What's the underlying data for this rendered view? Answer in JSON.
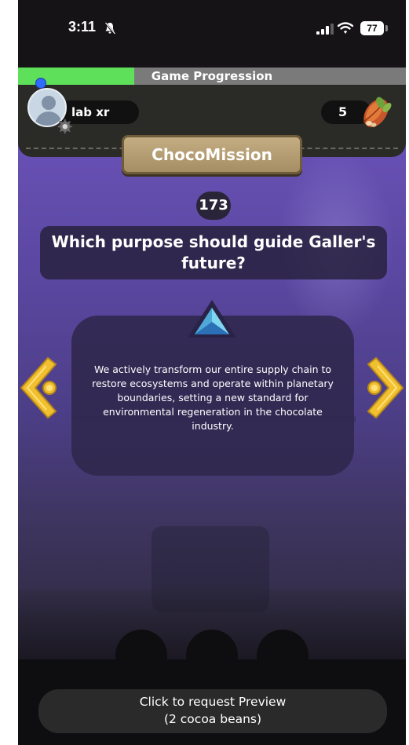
{
  "status_bar": {
    "time": "3:11",
    "battery": "77"
  },
  "progression": {
    "label": "Game Progression",
    "fraction": 0.3
  },
  "user": {
    "name": "lab xr"
  },
  "beans": {
    "count": "5"
  },
  "game": {
    "title": "ChocoMission",
    "question_number": "173",
    "question": "Which purpose should guide Galler's future?",
    "answer": "We actively transform our entire supply chain to restore ecosystems and operate within planetary boundaries, setting a new standard for environmental regeneration in the chocolate industry."
  },
  "preview": {
    "line1": "Click to request Preview",
    "line2": "(2 cocoa beans)"
  },
  "icons": {
    "status_bell": "bell-slash-icon",
    "signal": "cellular-signal-icon",
    "wifi": "wifi-icon",
    "battery": "battery-icon",
    "settings": "gear-icon",
    "avatar": "user-avatar-icon",
    "currency": "cocoa-pod-icon",
    "badge": "triangle-gem-icon",
    "prev": "chevron-left-icon",
    "next": "chevron-right-icon"
  },
  "colors": {
    "progress_fill": "#5fe05a",
    "progress_track": "#7a7a7a",
    "title_plate": "#c4ad82",
    "accent_gold": "#f0c030",
    "background_purple": "#5a47a0"
  }
}
